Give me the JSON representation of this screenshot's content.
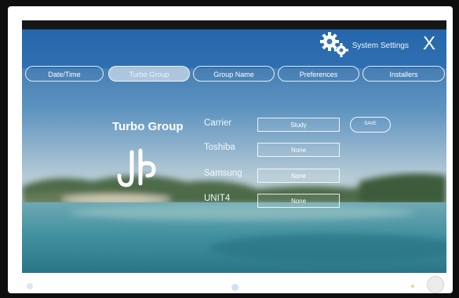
{
  "header": {
    "title": "System Settings",
    "settings_icon": "gear-icon",
    "close_label": "X"
  },
  "tabs": [
    {
      "label": "Date/Time",
      "active": false
    },
    {
      "label": "Turbo Group",
      "active": true
    },
    {
      "label": "Group Name",
      "active": false
    },
    {
      "label": "Preferences",
      "active": false
    },
    {
      "label": "Installers",
      "active": false
    }
  ],
  "main": {
    "title": "Turbo Group",
    "save_label": "SAVE",
    "rows": [
      {
        "label": "Carrier",
        "value": "Study"
      },
      {
        "label": "Toshiba",
        "value": "None"
      },
      {
        "label": "Samsung",
        "value": "None"
      },
      {
        "label": "UNIT4",
        "value": "None"
      }
    ]
  },
  "colors": {
    "header_bar": "#1e64af",
    "sky": "#2c6aa6",
    "water": "#3f8fa0"
  }
}
